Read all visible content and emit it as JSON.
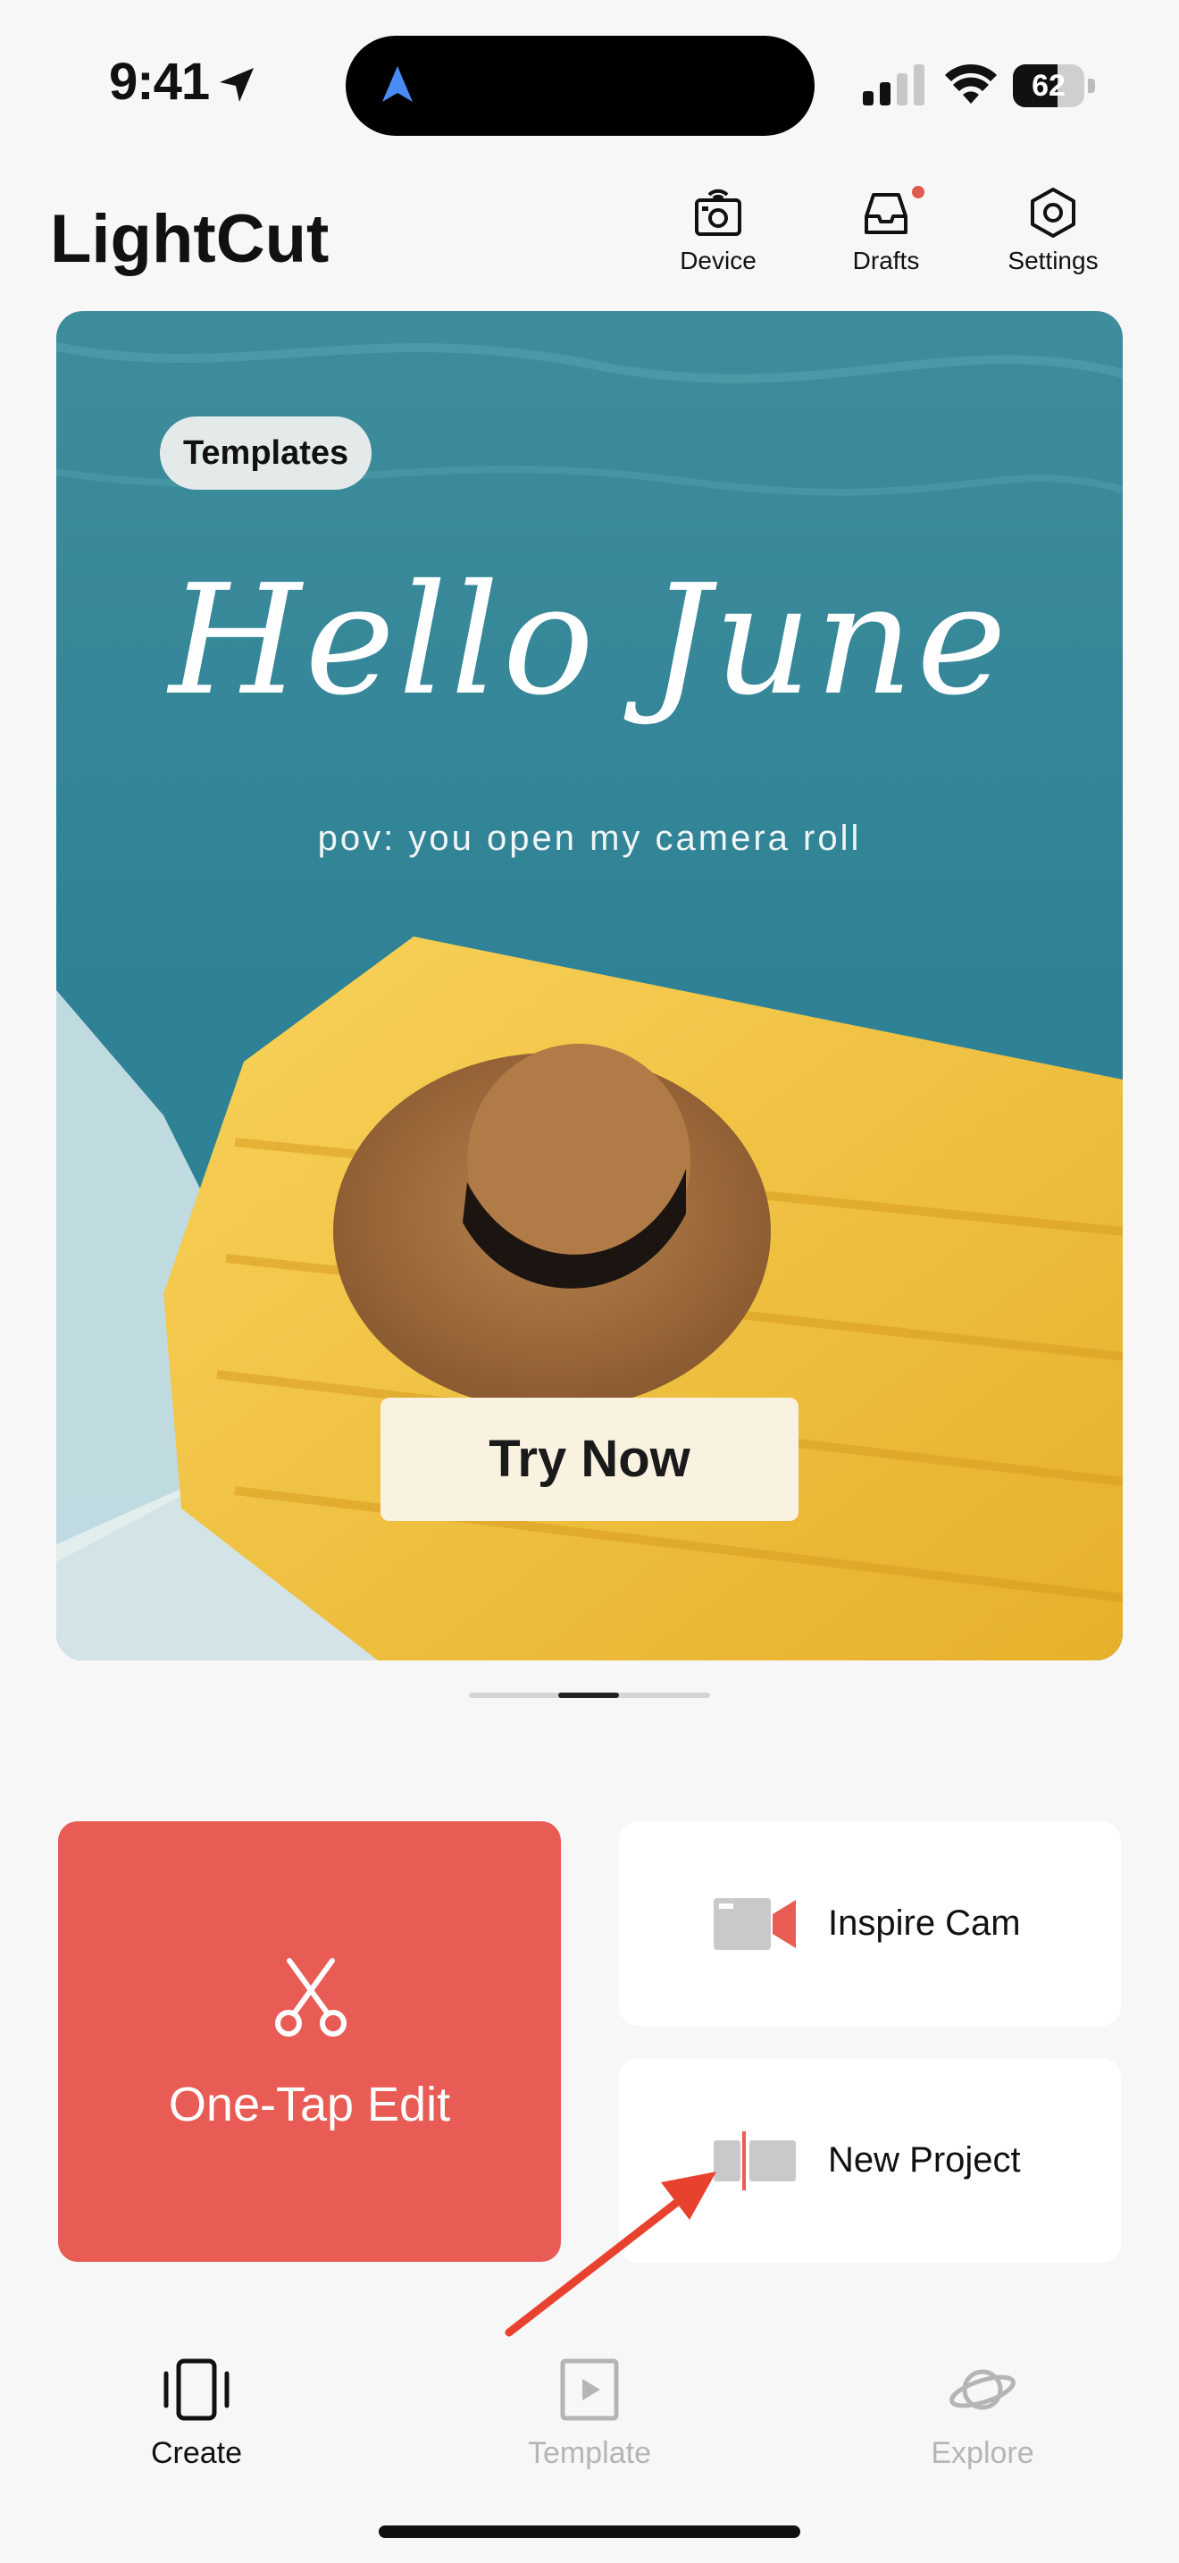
{
  "status_bar": {
    "time": "9:41",
    "battery": "62",
    "battery_level": 0.62
  },
  "header": {
    "app_title": "LightCut",
    "buttons": [
      {
        "label": "Device",
        "icon": "device-camera-icon"
      },
      {
        "label": "Drafts",
        "icon": "drafts-tray-icon",
        "has_notification_dot": true
      },
      {
        "label": "Settings",
        "icon": "settings-hexagon-icon"
      }
    ]
  },
  "banner": {
    "tag": "Templates",
    "headline": "Hello June",
    "subtitle": "pov: you open my camera roll",
    "cta": "Try Now",
    "pager_active_index": 1
  },
  "actions": {
    "one_tap": "One-Tap Edit",
    "inspire_cam": "Inspire Cam",
    "new_project": "New Project"
  },
  "tabs": [
    {
      "label": "Create",
      "icon": "create-phone-icon",
      "active": true
    },
    {
      "label": "Template",
      "icon": "template-play-icon",
      "active": false
    },
    {
      "label": "Explore",
      "icon": "explore-planet-icon",
      "active": false
    }
  ],
  "colors": {
    "accent": "#e85c55",
    "cta_bg": "#faf2e1",
    "pool": "#3a8a9e",
    "float": "#f2c23a"
  }
}
